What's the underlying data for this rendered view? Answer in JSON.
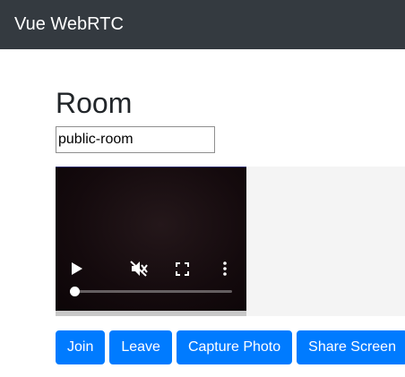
{
  "navbar": {
    "brand": "Vue WebRTC"
  },
  "room": {
    "title": "Room",
    "input_value": "public-room"
  },
  "video": {
    "controls": {
      "play_icon": "play-icon",
      "mute_icon": "muted-speaker-icon",
      "fullscreen_icon": "fullscreen-icon",
      "more_icon": "more-vertical-icon"
    },
    "progress": 0
  },
  "buttons": {
    "join": "Join",
    "leave": "Leave",
    "capture_photo": "Capture Photo",
    "share_screen": "Share Screen"
  },
  "colors": {
    "navbar_bg": "#343a40",
    "primary": "#007bff"
  }
}
